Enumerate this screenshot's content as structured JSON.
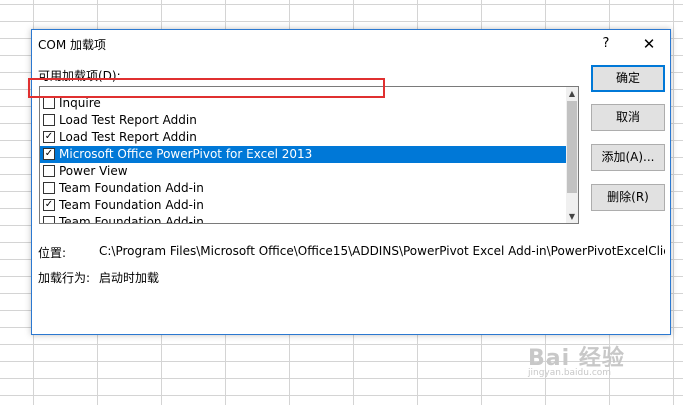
{
  "dialog": {
    "title": "COM 加载项",
    "help_label": "?",
    "close_label": "✕"
  },
  "list": {
    "label": "可用加载项(D):",
    "items": [
      {
        "label": "Inquire",
        "checked": false
      },
      {
        "label": "Load Test Report Addin",
        "checked": false
      },
      {
        "label": "Load Test Report Addin",
        "checked": true
      },
      {
        "label": "Microsoft Office PowerPivot for Excel 2013",
        "checked": true,
        "selected": true
      },
      {
        "label": "Power View",
        "checked": false
      },
      {
        "label": "Team Foundation Add-in",
        "checked": false
      },
      {
        "label": "Team Foundation Add-in",
        "checked": true
      },
      {
        "label": "Team Foundation Add-in",
        "checked": false
      }
    ]
  },
  "buttons": {
    "ok": "确定",
    "cancel": "取消",
    "add": "添加(A)...",
    "remove": "删除(R)"
  },
  "details": {
    "location_label": "位置:",
    "location_value": "C:\\Program Files\\Microsoft Office\\Office15\\ADDINS\\PowerPivot Excel Add-in\\PowerPivotExcelClie",
    "behavior_label": "加载行为:",
    "behavior_value": "启动时加载"
  },
  "watermark": {
    "main": "Bai 经验",
    "sub": "jingyan.baidu.com"
  },
  "icons": {
    "help": "help-icon",
    "close": "close-icon",
    "scroll_up": "chevron-up-icon",
    "scroll_down": "chevron-down-icon",
    "check": "checkmark-icon"
  },
  "colors": {
    "selection": "#0078d7",
    "highlight_box": "#e03030",
    "dialog_border": "#2b78d0"
  }
}
